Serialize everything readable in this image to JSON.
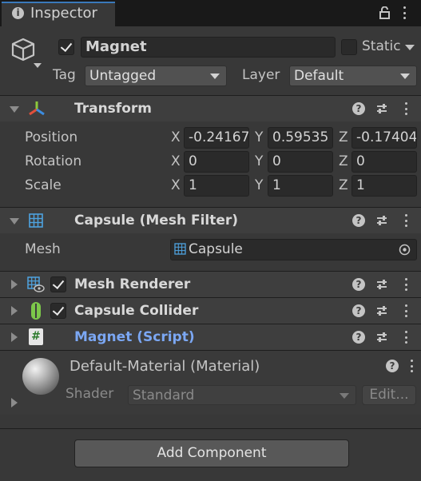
{
  "tab": {
    "title": "Inspector"
  },
  "gameobject": {
    "name": "Magnet",
    "static_label": "Static",
    "tag_label": "Tag",
    "tag_value": "Untagged",
    "layer_label": "Layer",
    "layer_value": "Default"
  },
  "transform": {
    "title": "Transform",
    "rows": [
      {
        "label": "Position",
        "x": "-0.24167",
        "y": "0.59535",
        "z": "-0.17404"
      },
      {
        "label": "Rotation",
        "x": "0",
        "y": "0",
        "z": "0"
      },
      {
        "label": "Scale",
        "x": "1",
        "y": "1",
        "z": "1"
      }
    ],
    "axis": {
      "x": "X",
      "y": "Y",
      "z": "Z"
    }
  },
  "mesh_filter": {
    "title": "Capsule (Mesh Filter)",
    "mesh_label": "Mesh",
    "mesh_value": "Capsule"
  },
  "mesh_renderer": {
    "title": "Mesh Renderer"
  },
  "capsule_collider": {
    "title": "Capsule Collider"
  },
  "script": {
    "title": "Magnet (Script)",
    "title_color": "#7ba7f3"
  },
  "material": {
    "title": "Default-Material (Material)",
    "shader_label": "Shader",
    "shader_value": "Standard",
    "edit_label": "Edit..."
  },
  "add_component": {
    "label": "Add Component"
  },
  "icons": {
    "help": "?",
    "info": "i",
    "script_icon": "#"
  }
}
